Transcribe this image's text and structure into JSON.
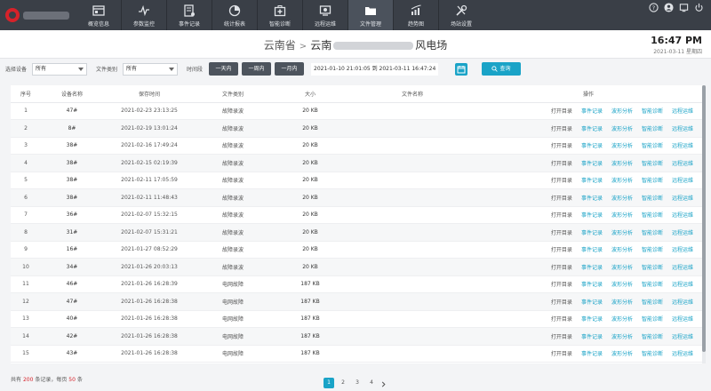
{
  "nav": {
    "items": [
      {
        "label": "概览信息",
        "icon": "overview-icon"
      },
      {
        "label": "参数监控",
        "icon": "monitor-icon"
      },
      {
        "label": "事件记录",
        "icon": "event-log-icon"
      },
      {
        "label": "统计报表",
        "icon": "pie-chart-icon"
      },
      {
        "label": "智能诊断",
        "icon": "medical-kit-icon"
      },
      {
        "label": "远程运维",
        "icon": "remote-ops-icon"
      },
      {
        "label": "文件管理",
        "icon": "folder-icon"
      },
      {
        "label": "趋势图",
        "icon": "trend-chart-icon"
      },
      {
        "label": "场站设置",
        "icon": "tools-icon"
      }
    ],
    "active_index": 6
  },
  "header": {
    "province": "云南省",
    "site_prefix": "云南",
    "site_suffix": "风电场",
    "time": "16:47 PM",
    "date": "2021-03-11 星期四"
  },
  "filters": {
    "device_label": "选择设备",
    "device_value": "所有",
    "type_label": "文件类别",
    "type_value": "所有",
    "period_label": "时间段",
    "quick": [
      "一天内",
      "一周内",
      "一月内"
    ],
    "date_range": "2021-01-10 21:01:05 到 2021-03-11 16:47:24",
    "search_label": "查询"
  },
  "table": {
    "headers": [
      "序号",
      "设备名称",
      "保存时间",
      "文件类别",
      "大小",
      "文件名称",
      "操作"
    ],
    "ops": [
      "打开目录",
      "事件记录",
      "波形分析",
      "智能诊断",
      "远程运维"
    ],
    "rows": [
      {
        "no": "1",
        "device": "47#",
        "time": "2021-02-23 23:13:25",
        "type": "故障录波",
        "size": "20 KB"
      },
      {
        "no": "2",
        "device": "8#",
        "time": "2021-02-19 13:01:24",
        "type": "故障录波",
        "size": "20 KB"
      },
      {
        "no": "3",
        "device": "38#",
        "time": "2021-02-16 17:49:24",
        "type": "故障录波",
        "size": "20 KB"
      },
      {
        "no": "4",
        "device": "38#",
        "time": "2021-02-15 02:19:39",
        "type": "故障录波",
        "size": "20 KB"
      },
      {
        "no": "5",
        "device": "38#",
        "time": "2021-02-11 17:05:59",
        "type": "故障录波",
        "size": "20 KB"
      },
      {
        "no": "6",
        "device": "38#",
        "time": "2021-02-11 11:48:43",
        "type": "故障录波",
        "size": "20 KB"
      },
      {
        "no": "7",
        "device": "36#",
        "time": "2021-02-07 15:32:15",
        "type": "故障录波",
        "size": "20 KB"
      },
      {
        "no": "8",
        "device": "31#",
        "time": "2021-02-07 15:31:21",
        "type": "故障录波",
        "size": "20 KB"
      },
      {
        "no": "9",
        "device": "16#",
        "time": "2021-01-27 08:52:29",
        "type": "故障录波",
        "size": "20 KB"
      },
      {
        "no": "10",
        "device": "34#",
        "time": "2021-01-26 20:03:13",
        "type": "故障录波",
        "size": "20 KB"
      },
      {
        "no": "11",
        "device": "46#",
        "time": "2021-01-26 16:28:39",
        "type": "电网故障",
        "size": "187 KB"
      },
      {
        "no": "12",
        "device": "47#",
        "time": "2021-01-26 16:28:38",
        "type": "电网故障",
        "size": "187 KB"
      },
      {
        "no": "13",
        "device": "40#",
        "time": "2021-01-26 16:28:38",
        "type": "电网故障",
        "size": "187 KB"
      },
      {
        "no": "14",
        "device": "42#",
        "time": "2021-01-26 16:28:38",
        "type": "电网故障",
        "size": "187 KB"
      },
      {
        "no": "15",
        "device": "43#",
        "time": "2021-01-26 16:28:38",
        "type": "电网故障",
        "size": "187 KB"
      }
    ]
  },
  "footer": {
    "prefix": "共有",
    "total": "200",
    "mid": "条记录，每页",
    "per_page": "50",
    "suffix": "条"
  },
  "pager": {
    "pages": [
      "1",
      "2",
      "3",
      "4"
    ],
    "current": "1"
  }
}
